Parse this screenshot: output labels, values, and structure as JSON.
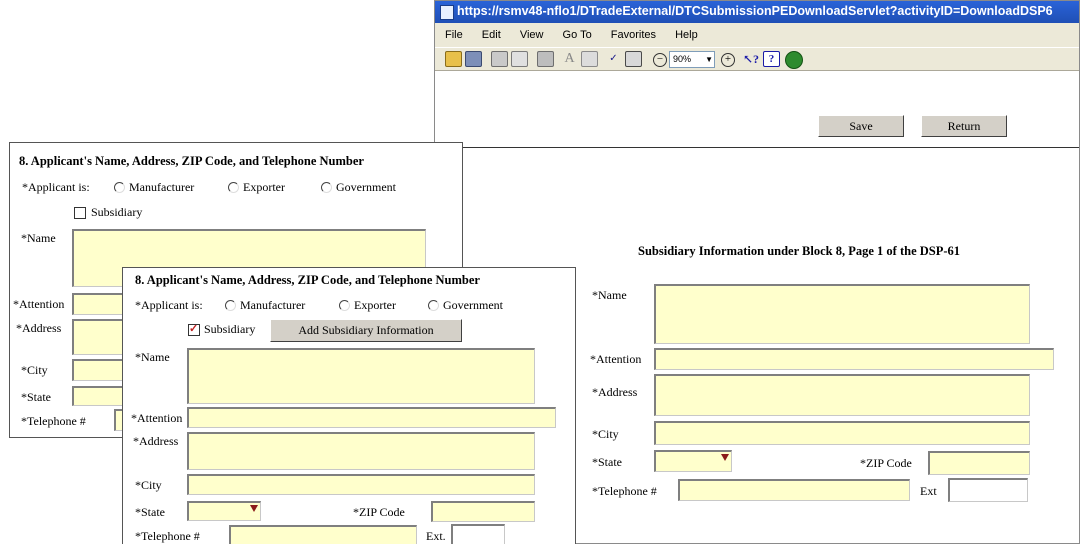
{
  "browser": {
    "url": "https://rsmv48-nflo1/DTradeExternal/DTCSubmissionPEDownloadServlet?activityID=DownloadDSP6",
    "menu": [
      "File",
      "Edit",
      "View",
      "Go To",
      "Favorites",
      "Help"
    ],
    "zoom": "90%",
    "save_label": "Save",
    "return_label": "Return"
  },
  "subsidiary_form": {
    "title": "Subsidiary Information under Block 8, Page 1 of the DSP-61",
    "name": "*Name",
    "attention": "*Attention",
    "address": "*Address",
    "city": "*City",
    "state": "*State",
    "zip": "*ZIP Code",
    "telephone": "*Telephone #",
    "ext": "Ext"
  },
  "back_form": {
    "title": "8.  Applicant's Name, Address, ZIP Code, and Telephone Number",
    "applicant_is": "*Applicant is:",
    "options": [
      "Manufacturer",
      "Exporter",
      "Government"
    ],
    "subsidiary": "Subsidiary",
    "name": "*Name",
    "attention": "*Attention",
    "address": "*Address",
    "city": "*City",
    "state": "*State",
    "telephone": "*Telephone #"
  },
  "front_form": {
    "title": "8.  Applicant's Name, Address, ZIP Code, and Telephone Number",
    "applicant_is": "*Applicant is:",
    "options": [
      "Manufacturer",
      "Exporter",
      "Government"
    ],
    "subsidiary": "Subsidiary",
    "add_subsidiary_label": "Add Subsidiary Information",
    "name": "*Name",
    "attention": "*Attention",
    "address": "*Address",
    "city": "*City",
    "state": "*State",
    "zip": "*ZIP Code",
    "telephone": "*Telephone #",
    "ext": "Ext."
  }
}
